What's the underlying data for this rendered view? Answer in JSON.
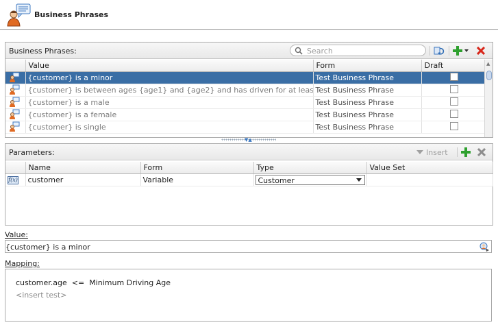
{
  "header": {
    "title": "Business Phrases",
    "icon": "business-phrases-icon"
  },
  "phrases_panel": {
    "title": "Business Phrases:",
    "search_placeholder": "Search",
    "columns": [
      "Value",
      "Form",
      "Draft"
    ],
    "rows": [
      {
        "value": "{customer} is a minor",
        "form": "Test Business Phrase",
        "draft": false,
        "selected": true
      },
      {
        "value": "{customer} is between ages {age1}  and {age2} and has driven for at least {ye...",
        "form": "Test Business Phrase",
        "draft": false,
        "selected": false
      },
      {
        "value": "{customer} is a male",
        "form": "Test Business Phrase",
        "draft": false,
        "selected": false
      },
      {
        "value": "{customer} is a female",
        "form": "Test Business Phrase",
        "draft": false,
        "selected": false
      },
      {
        "value": "{customer} is single",
        "form": "Test Business Phrase",
        "draft": false,
        "selected": false
      }
    ]
  },
  "parameters_panel": {
    "title": "Parameters:",
    "insert_label": "Insert",
    "columns": [
      "Name",
      "Form",
      "Type",
      "Value Set"
    ],
    "rows": [
      {
        "icon": "f(x)",
        "name": "customer",
        "form": "Variable",
        "type": "Customer",
        "value_set": ""
      }
    ]
  },
  "value_section": {
    "label": "Value:",
    "value": "{customer} is a minor"
  },
  "mapping_section": {
    "label": "Mapping:",
    "lines": [
      "customer.age  <=  Minimum Driving Age",
      "<insert test>"
    ]
  },
  "colors": {
    "selection": "#3a6ea5",
    "add_green": "#2ea02e",
    "delete_red": "#d8261a"
  }
}
